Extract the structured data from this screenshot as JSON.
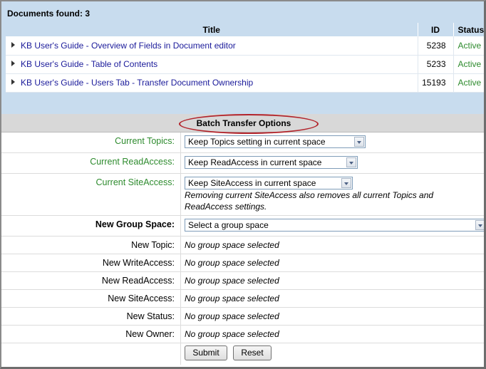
{
  "documents": {
    "count_label": "Documents found: 3",
    "columns": [
      "Title",
      "ID",
      "Status"
    ],
    "rows": [
      {
        "title": "KB User's Guide - Overview of Fields in Document editor",
        "id": "5238",
        "status": "Active"
      },
      {
        "title": "KB User's Guide - Table of Contents",
        "id": "5233",
        "status": "Active"
      },
      {
        "title": "KB User's Guide - Users Tab - Transfer Document Ownership",
        "id": "15193",
        "status": "Active"
      }
    ]
  },
  "batch": {
    "title": "Batch Transfer Options",
    "current_topics": {
      "label": "Current Topics:",
      "value": "Keep Topics setting in current space"
    },
    "current_readaccess": {
      "label": "Current ReadAccess:",
      "value": "Keep ReadAccess in current space"
    },
    "current_siteaccess": {
      "label": "Current SiteAccess:",
      "value": "Keep SiteAccess in current space",
      "note": "Removing current SiteAccess also removes all current Topics and ReadAccess settings."
    },
    "new_group_space": {
      "label": "New Group Space:",
      "value": "Select a group space"
    },
    "new_topic": {
      "label": "New Topic:",
      "value": "No group space selected"
    },
    "new_writeaccess": {
      "label": "New WriteAccess:",
      "value": "No group space selected"
    },
    "new_readaccess": {
      "label": "New ReadAccess:",
      "value": "No group space selected"
    },
    "new_siteaccess": {
      "label": "New SiteAccess:",
      "value": "No group space selected"
    },
    "new_status": {
      "label": "New Status:",
      "value": "No group space selected"
    },
    "new_owner": {
      "label": "New Owner:",
      "value": "No group space selected"
    },
    "submit_label": "Submit",
    "reset_label": "Reset"
  },
  "colors": {
    "accent_green": "#2e8b2e",
    "link_blue": "#1a1a9a",
    "highlight_red": "#b2232a",
    "panel_blue": "#c8dcee"
  }
}
